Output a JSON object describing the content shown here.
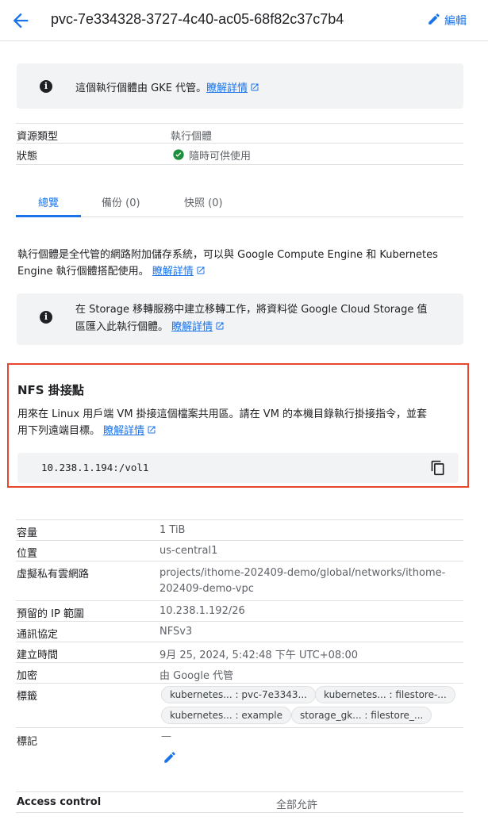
{
  "header": {
    "title": "pvc-7e334328-3727-4c40-ac05-68f82c37c7b4",
    "edit_label": "編輯"
  },
  "notice": {
    "text": "這個執行個體由 GKE 代管。",
    "link": "瞭解詳情"
  },
  "summary": {
    "resource_type_key": "資源類型",
    "resource_type_val": "執行個體",
    "status_key": "狀態",
    "status_val": "隨時可供使用"
  },
  "tabs": [
    "總覽",
    "備份 (0)",
    "快照 (0)"
  ],
  "overview": {
    "desc_line1": "執行個體是全代管的網路附加儲存系統，可以與 Google Compute Engine 和 Kubernetes",
    "desc_line2": "Engine 執行個體搭配使用。",
    "desc_link": "瞭解詳情",
    "migrate_line1": "在 Storage 移轉服務中建立移轉工作，將資料從 Google Cloud Storage 值",
    "migrate_line2": "區匯入此執行個體。",
    "migrate_link": "瞭解詳情"
  },
  "nfs": {
    "title": "NFS 掛接點",
    "desc_line1": "用來在 Linux 用戶端 VM 掛接這個檔案共用區。請在 VM 的本機目錄執行掛接指令，並套",
    "desc_line2": "用下列遠端目標。",
    "link": "瞭解詳情",
    "mount": "10.238.1.194:/vol1"
  },
  "details": {
    "capacity_key": "容量",
    "capacity_val": "1 TiB",
    "location_key": "位置",
    "location_val": "us-central1",
    "vpc_key": "虛擬私有雲網路",
    "vpc_val1": "projects/ithome-202409-demo/global/networks/ithome-",
    "vpc_val2": "202409-demo-vpc",
    "ip_key": "預留的 IP 範圍",
    "ip_val": "10.238.1.192/26",
    "protocol_key": "通訊協定",
    "protocol_val": "NFSv3",
    "created_key": "建立時間",
    "created_val": "9月 25, 2024, 5:42:48 下午 UTC+08:00",
    "encryption_key": "加密",
    "encryption_val": "由 Google 代管",
    "labels_key": "標籤",
    "labels": [
      "kubernetes... : pvc-7e3343...",
      "kubernetes... : filestore-...",
      "kubernetes... : example",
      "storage_gk... : filestore_..."
    ],
    "tags_key": "標記",
    "tags_val": "—"
  },
  "access": {
    "key": "Access control",
    "val": "全部允許"
  }
}
